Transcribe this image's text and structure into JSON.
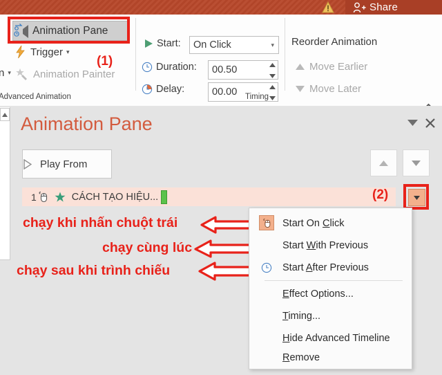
{
  "titlebar": {
    "warning_icon": "warning-triangle-icon",
    "share_label": "Share",
    "share_icon": "person-add-icon",
    "bg_color": "#b7472a"
  },
  "ribbon": {
    "advanced_animation": {
      "group_label": "Advanced Animation",
      "animation_pane_button": "Animation Pane",
      "animation_pane_icon": "animation-pane-icon",
      "trigger_button": "Trigger",
      "trigger_icon": "lightning-bolt-icon",
      "trigger_caret": "▾",
      "animation_painter_button": "Animation Painter",
      "animation_painter_icon": "star-brush-icon",
      "partial_gallery_label": "n",
      "partial_gallery_caret": "▾",
      "callout_marker": "(1)"
    },
    "timing": {
      "group_label": "Timing",
      "start_label": "Start:",
      "start_icon": "play-triangle-icon",
      "start_value": "On Click",
      "start_caret": "▾",
      "duration_label": "Duration:",
      "duration_icon": "clock-icon",
      "duration_value": "00.50",
      "delay_label": "Delay:",
      "delay_icon": "clock-delay-icon",
      "delay_value": "00.00"
    },
    "reorder": {
      "title": "Reorder Animation",
      "move_earlier": "Move Earlier",
      "move_earlier_icon": "triangle-up-icon",
      "move_later": "Move Later",
      "move_later_icon": "triangle-down-icon",
      "collapse_icon": "chevron-up-icon"
    }
  },
  "animation_pane": {
    "title": "Animation Pane",
    "collapse_caret_icon": "caret-down-icon",
    "close_icon": "close-x-icon",
    "play_from_button": "Play From",
    "play_from_icon": "play-outline-icon",
    "move_up_icon": "triangle-up-icon",
    "move_down_icon": "triangle-down-icon",
    "item": {
      "number": "1",
      "trigger_icon": "mouse-click-icon",
      "effect_icon": "green-star-icon",
      "label": "CÁCH TẠO HIỆU...",
      "timeline_bar_color": "#5bc24a",
      "dropdown_icon": "caret-down-icon",
      "callout_marker": "(2)"
    }
  },
  "context_menu": {
    "items": [
      {
        "label_pre": "Start On ",
        "accel": "C",
        "label_post": "lick",
        "icon": "mouse-click-icon",
        "icon_selected": true
      },
      {
        "label_pre": "Start ",
        "accel": "W",
        "label_post": "ith Previous",
        "icon": "none",
        "icon_selected": false
      },
      {
        "label_pre": "Start ",
        "accel": "A",
        "label_post": "fter Previous",
        "icon": "clock-icon",
        "icon_selected": false
      },
      {
        "label_pre": "",
        "accel": "E",
        "label_post": "ffect Options...",
        "icon": "none",
        "icon_selected": false
      },
      {
        "label_pre": "",
        "accel": "T",
        "label_post": "iming...",
        "icon": "none",
        "icon_selected": false
      },
      {
        "label_pre": "",
        "accel": "H",
        "label_post": "ide Advanced Timeline",
        "icon": "none",
        "icon_selected": false
      },
      {
        "label_pre": "",
        "accel": "R",
        "label_post": "emove",
        "icon": "none",
        "icon_selected": false
      }
    ]
  },
  "annotations": {
    "note_1": "chạy khi nhấn chuột trái",
    "note_2": "chạy cùng lúc",
    "note_3": "chạy sau khi trình chiếu",
    "color": "#e8221a"
  }
}
